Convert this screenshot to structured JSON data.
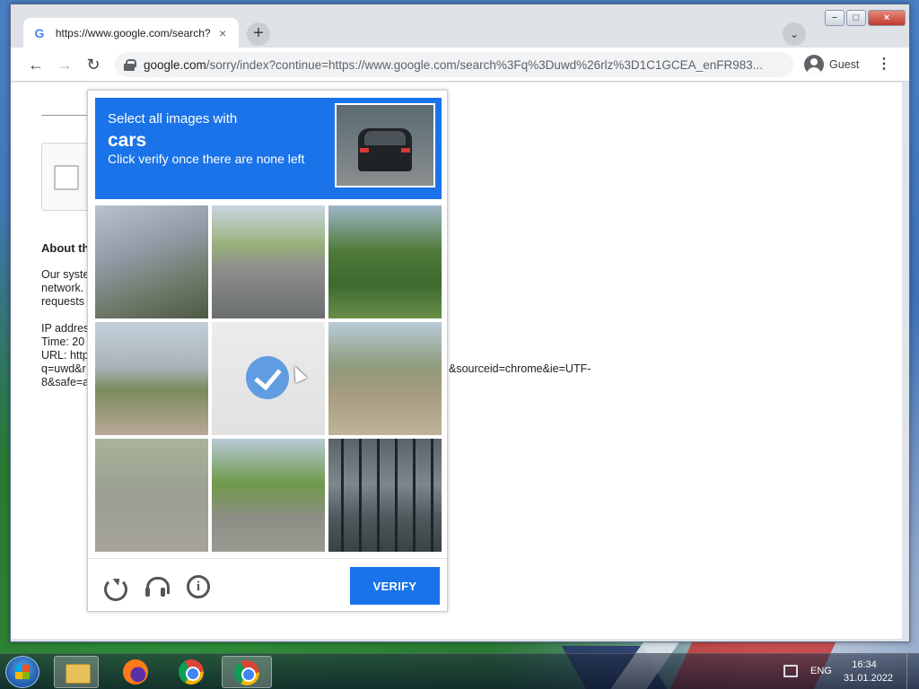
{
  "browser": {
    "tab": {
      "title": "https://www.google.com/search?",
      "close": "×"
    },
    "new_tab": "+",
    "tab_search": "⌄",
    "window_buttons": {
      "minimize": "−",
      "maximize": "□",
      "close": "×"
    },
    "nav": {
      "back": "←",
      "forward": "→",
      "reload": "↻"
    },
    "url_host": "google.com",
    "url_rest": "/sorry/index?continue=https://www.google.com/search%3Fq%3Duwd%26rlz%3D1C1GCEA_enFR983...",
    "profile_label": "Guest",
    "menu": "⋮"
  },
  "page": {
    "about_heading": "About th",
    "para1": [
      "Our syste",
      "network.",
      "requests"
    ],
    "ip_line": "IP addres",
    "time_line": "Time: 20",
    "url_line": "URL: http",
    "url_cont1": "q=uwd&r",
    "url_cont2": "8&safe=a",
    "url_tail": "&sourceid=chrome&ie=UTF-",
    "url_tail2": "8"
  },
  "captcha": {
    "line1": "Select all images with",
    "target": "cars",
    "line3": "Click verify once there are none left",
    "verify_label": "VERIFY",
    "colors": {
      "header": "#1a73e8",
      "button": "#1a73e8"
    }
  },
  "taskbar": {
    "language": "ENG",
    "time": "16:34",
    "date": "31.01.2022"
  }
}
